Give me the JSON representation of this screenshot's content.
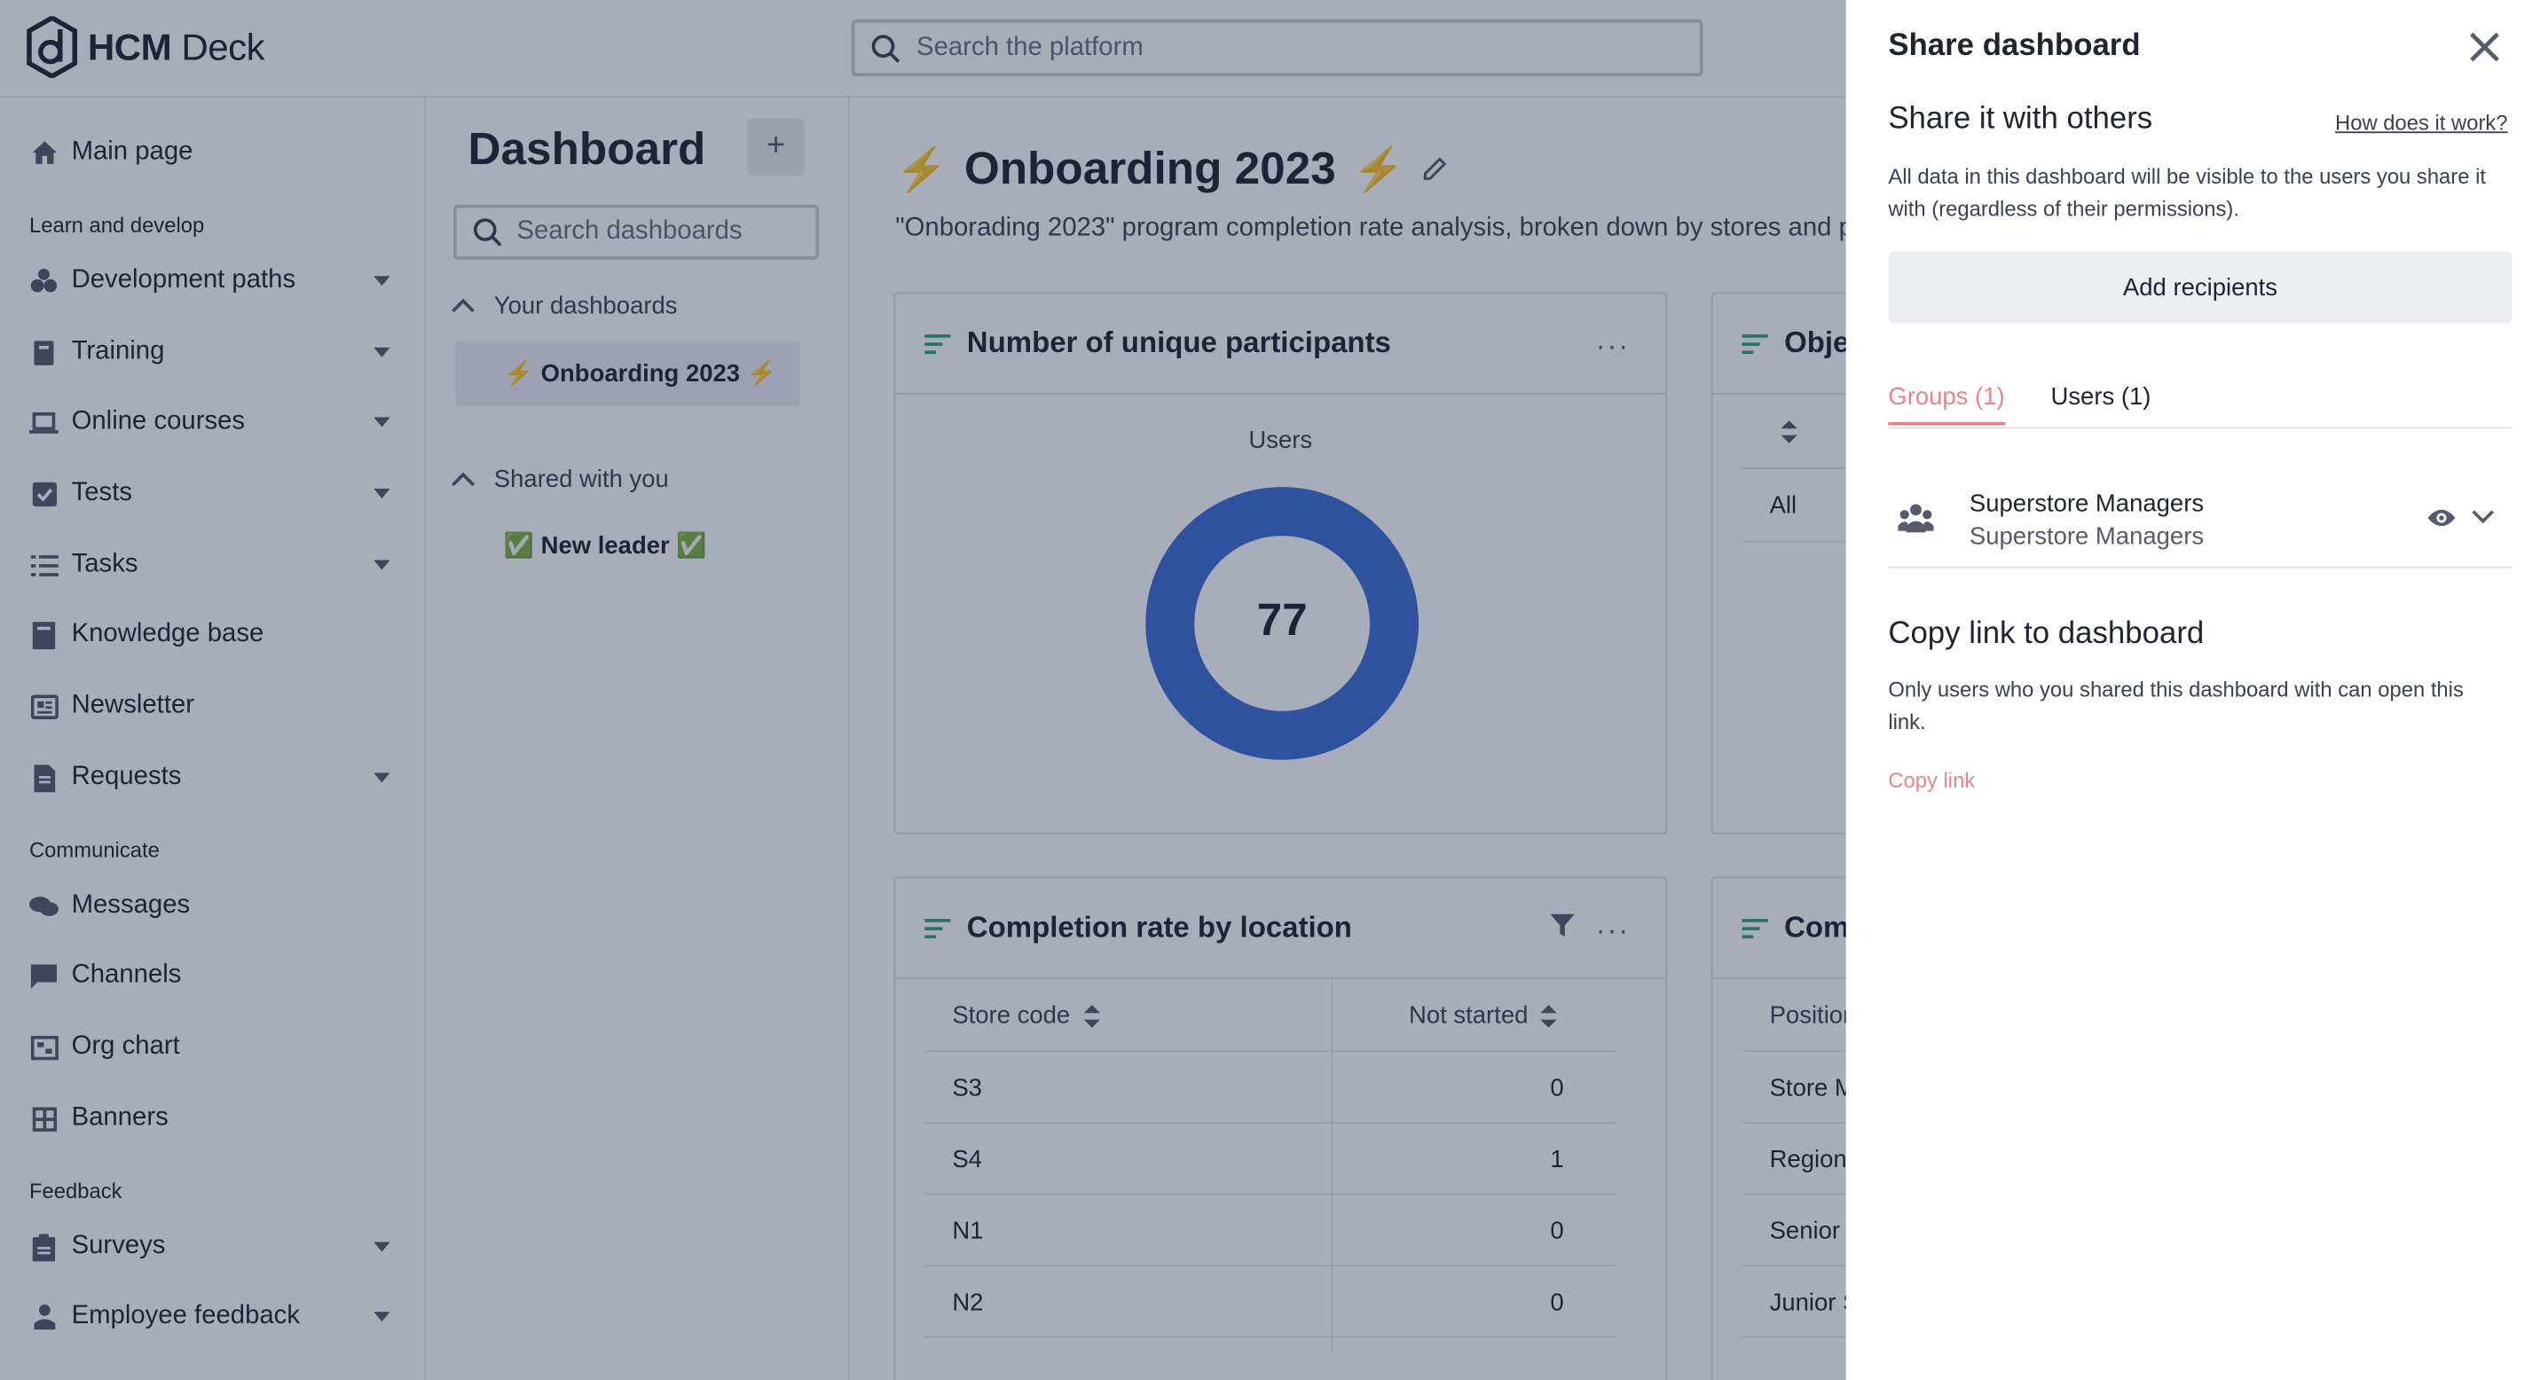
{
  "app": {
    "brand_bold": "HCM",
    "brand_light": " Deck",
    "search_placeholder": "Search the platform"
  },
  "nav": {
    "main_page": "Main page",
    "section_learn": "Learn and develop",
    "development_paths": "Development paths",
    "training": "Training",
    "online_courses": "Online courses",
    "tests": "Tests",
    "tasks": "Tasks",
    "knowledge_base": "Knowledge base",
    "newsletter": "Newsletter",
    "requests": "Requests",
    "section_communicate": "Communicate",
    "messages": "Messages",
    "channels": "Channels",
    "org_chart": "Org chart",
    "banners": "Banners",
    "section_feedback": "Feedback",
    "surveys": "Surveys",
    "employee_feedback": "Employee feedback"
  },
  "dashboards": {
    "title": "Dashboard",
    "add": "+",
    "search_placeholder": "Search dashboards",
    "your_dashboards": "Your dashboards",
    "your_items": [
      "⚡ Onboarding 2023 ⚡"
    ],
    "shared_with_you": "Shared with you",
    "shared_items": [
      "✅ New leader ✅"
    ]
  },
  "main": {
    "title": "Onboarding 2023",
    "bolt": "⚡",
    "description": "\"Onborading 2023\" program completion rate analysis, broken down by stores and positions",
    "card1": {
      "title": "Number of unique participants",
      "more": "···",
      "label": "Users",
      "value": "77"
    },
    "card2": {
      "title": "Objectives",
      "row1": "All"
    },
    "card3": {
      "title": "Completion rate by location",
      "more": "···",
      "col1": "Store code",
      "col2": "Not started",
      "rows": [
        {
          "code": "S3",
          "not_started": "0"
        },
        {
          "code": "S4",
          "not_started": "1"
        },
        {
          "code": "N1",
          "not_started": "0"
        },
        {
          "code": "N2",
          "not_started": "0"
        }
      ]
    },
    "card4": {
      "title": "Completion rate by position",
      "col1": "Position",
      "rows": [
        "Store Manager",
        "Regional Manager",
        "Senior Associate",
        "Junior Store Associate"
      ]
    }
  },
  "drawer": {
    "title": "Share dashboard",
    "subtitle": "Share it with others",
    "how": "How does it work?",
    "note": "All data in this dashboard will be visible to the users you share it with (regardless of their permissions).",
    "add_recipients": "Add recipients",
    "tab_groups": "Groups (1)",
    "tab_users": "Users (1)",
    "group_name": "Superstore Managers",
    "group_sub": "Superstore Managers",
    "copy_title": "Copy link to dashboard",
    "copy_note": "Only users who you shared this dashboard with can open this link.",
    "copy_link": "Copy link"
  },
  "colors": {
    "accent_pink": "#e8838d",
    "donut_blue": "#3b6fd4",
    "bolt_orange": "#e8a33b",
    "teal_bars": "#2fa37a"
  }
}
